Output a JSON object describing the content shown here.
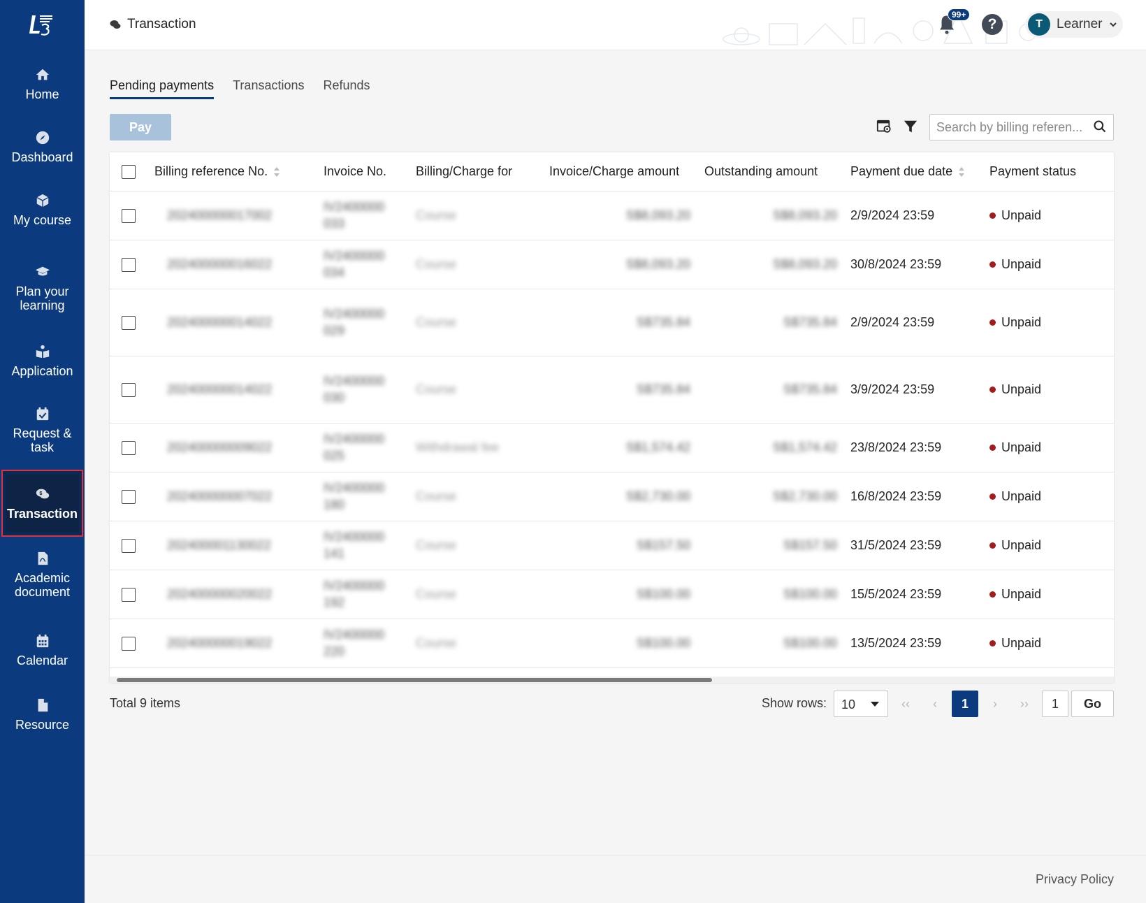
{
  "sidebar": {
    "items": [
      {
        "label": "Home",
        "icon": "home-icon"
      },
      {
        "label": "Dashboard",
        "icon": "compass-icon"
      },
      {
        "label": "My course",
        "icon": "cube-icon"
      },
      {
        "label": "Plan your learning",
        "icon": "graduation-cap-icon"
      },
      {
        "label": "Application",
        "icon": "reader-icon"
      },
      {
        "label": "Request & task",
        "icon": "calendar-check-icon"
      },
      {
        "label": "Transaction",
        "icon": "coin-chat-icon",
        "active": true
      },
      {
        "label": "Academic document",
        "icon": "pdf-file-icon"
      },
      {
        "label": "Calendar",
        "icon": "calendar-icon"
      },
      {
        "label": "Resource",
        "icon": "file-icon"
      }
    ]
  },
  "header": {
    "title": "Transaction",
    "notification_badge": "99+",
    "help_glyph": "?",
    "user_initial": "T",
    "user_name": "Learner"
  },
  "tabs": [
    {
      "label": "Pending payments",
      "active": true
    },
    {
      "label": "Transactions",
      "active": false
    },
    {
      "label": "Refunds",
      "active": false
    }
  ],
  "toolbar": {
    "pay_label": "Pay",
    "search_placeholder": "Search by billing referen..."
  },
  "table": {
    "columns": [
      "Billing reference No.",
      "Invoice No.",
      "Billing/Charge for",
      "Invoice/Charge amount",
      "Outstanding amount",
      "Payment due date",
      "Payment status"
    ],
    "rows": [
      {
        "billing_ref": "202400000017002",
        "invoice": "IV2400000 033",
        "charge_for": "Course",
        "amount": "S$8,093.20",
        "outstanding": "S$8,093.20",
        "due": "2/9/2024 23:59",
        "status": "Unpaid"
      },
      {
        "billing_ref": "202400000016022",
        "invoice": "IV2400000 034",
        "charge_for": "Course",
        "amount": "S$8,093.20",
        "outstanding": "S$8,093.20",
        "due": "30/8/2024 23:59",
        "status": "Unpaid"
      },
      {
        "billing_ref": "202400000014022",
        "invoice": "IV2400000 029",
        "charge_for": "Course",
        "amount": "S$735.84",
        "outstanding": "S$735.84",
        "due": "2/9/2024 23:59",
        "status": "Unpaid"
      },
      {
        "billing_ref": "202400000014022",
        "invoice": "IV2400000 030",
        "charge_for": "Course",
        "amount": "S$735.84",
        "outstanding": "S$735.84",
        "due": "3/9/2024 23:59",
        "status": "Unpaid"
      },
      {
        "billing_ref": "202400000009022",
        "invoice": "IV2400000 025",
        "charge_for": "Withdrawal fee",
        "amount": "S$1,574.42",
        "outstanding": "S$1,574.42",
        "due": "23/8/2024 23:59",
        "status": "Unpaid"
      },
      {
        "billing_ref": "202400000007022",
        "invoice": "IV2400000 180",
        "charge_for": "Course",
        "amount": "S$2,730.00",
        "outstanding": "S$2,730.00",
        "due": "16/8/2024 23:59",
        "status": "Unpaid"
      },
      {
        "billing_ref": "202400001130022",
        "invoice": "IV2400000 141",
        "charge_for": "Course",
        "amount": "S$157.50",
        "outstanding": "S$157.50",
        "due": "31/5/2024 23:59",
        "status": "Unpaid"
      },
      {
        "billing_ref": "202400000020022",
        "invoice": "IV2400000 192",
        "charge_for": "Course",
        "amount": "S$100.00",
        "outstanding": "S$100.00",
        "due": "15/5/2024 23:59",
        "status": "Unpaid"
      },
      {
        "billing_ref": "202400000019022",
        "invoice": "IV2400000 220",
        "charge_for": "Course",
        "amount": "S$100.00",
        "outstanding": "S$100.00",
        "due": "13/5/2024 23:59",
        "status": "Unpaid"
      }
    ]
  },
  "pagination": {
    "total": "Total 9 items",
    "show_rows_label": "Show rows:",
    "rows_value": "10",
    "current_page": "1",
    "goto_value": "1",
    "go_label": "Go"
  },
  "footer": {
    "privacy": "Privacy Policy"
  },
  "colors": {
    "sidebar_bg": "#0b3b7e",
    "active_outline": "#e0313b",
    "status_unpaid": "#a61b1b",
    "pay_disabled": "#a8c2dc"
  }
}
